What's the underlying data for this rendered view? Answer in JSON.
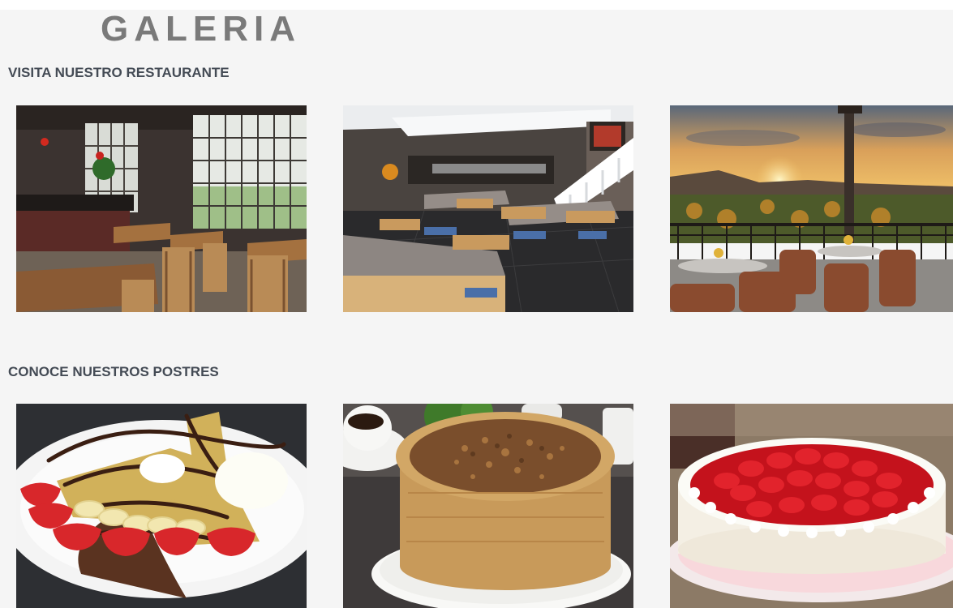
{
  "gallery": {
    "title": "GALERIA",
    "sections": [
      {
        "heading": "VISITA NUESTRO RESTAURANTE",
        "images": [
          {
            "icon": "restaurant-interior-photo"
          },
          {
            "icon": "dining-room-photo"
          },
          {
            "icon": "sunset-terrace-photo"
          }
        ]
      },
      {
        "heading": "CONOCE NUESTROS POSTRES",
        "images": [
          {
            "icon": "strawberry-crepe-photo"
          },
          {
            "icon": "pecan-cake-photo"
          },
          {
            "icon": "strawberry-cheesecake-photo"
          }
        ]
      }
    ]
  }
}
